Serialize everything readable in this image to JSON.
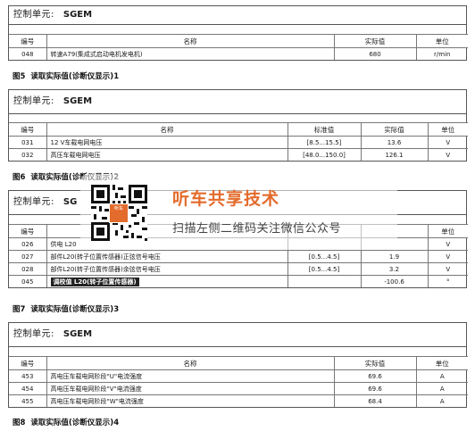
{
  "panels": [
    {
      "header_label": "控制单元:",
      "header_value": "SGEM",
      "columns": [
        "编号",
        "名称",
        "实际值",
        "单位"
      ],
      "rows": [
        [
          "048",
          "转速A79(集成式启动电机发电机)",
          "680",
          "r/min"
        ]
      ],
      "caption_fig": "图5",
      "caption_text": "读取实际值(诊断仪显示)1"
    },
    {
      "header_label": "控制单元:",
      "header_value": "SGEM",
      "columns": [
        "编号",
        "名称",
        "标准值",
        "实际值",
        "单位"
      ],
      "rows": [
        [
          "031",
          "12 V车载电网电压",
          "[8.5...15.5]",
          "13.6",
          "V"
        ],
        [
          "032",
          "高压车载电网电压",
          "[48.0...150.0]",
          "126.1",
          "V"
        ]
      ],
      "caption_fig": "图6",
      "caption_text": "读取实际值(诊断仪显示)2"
    },
    {
      "header_label": "控制单元:",
      "header_value": "SG",
      "columns": [
        "编号",
        "",
        "",
        "",
        "单位"
      ],
      "rows": [
        [
          "026",
          "供电 L20",
          "",
          "",
          "V"
        ],
        [
          "027",
          "部件L20(转子位置传感器)正弦信号电压",
          "[0.5...4.5]",
          "1.9",
          "V"
        ],
        [
          "028",
          "部件L20(转子位置传感器)余弦信号电压",
          "[0.5...4.5]",
          "3.2",
          "V"
        ],
        [
          "045",
          "调校值 L20(转子位置传感器)",
          "",
          "-100.6",
          "°"
        ]
      ],
      "caption_fig": "图7",
      "caption_text": "读取实际值(诊断仪显示)3"
    },
    {
      "header_label": "控制单元:",
      "header_value": "SGEM",
      "columns": [
        "编号",
        "名称",
        "实际值",
        "单位"
      ],
      "rows": [
        [
          "453",
          "高电压车载电网阶段\"U\"电流强度",
          "69.6",
          "A"
        ],
        [
          "454",
          "高电压车载电网阶段\"V\"电流强度",
          "69.6",
          "A"
        ],
        [
          "455",
          "高电压车载电网阶段\"W\"电流强度",
          "68.4",
          "A"
        ]
      ],
      "caption_fig": "图8",
      "caption_text": "读取实际值(诊断仪显示)4"
    }
  ],
  "watermark": {
    "title": "听车共享技术",
    "subtitle": "扫描左侧二维码关注微信公众号",
    "logo_text": "听车"
  }
}
